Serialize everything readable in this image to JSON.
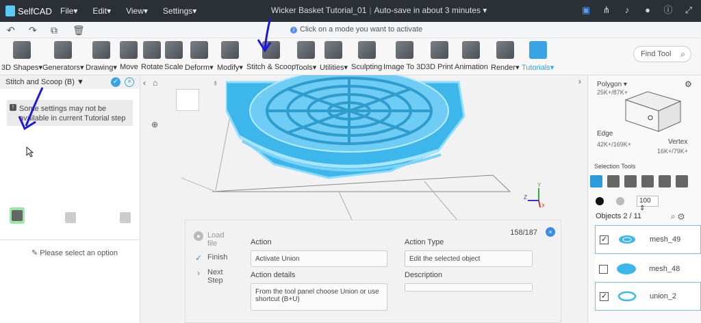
{
  "app": {
    "name": "SelfCAD"
  },
  "menus": [
    "File",
    "Edit",
    "View",
    "Settings"
  ],
  "document": {
    "title": "Wicker Basket Tutorial_01",
    "autosave": "Auto-save in about 3 minutes"
  },
  "hint": "Click on a mode you want to activate",
  "tools": [
    {
      "label": "3D Shapes",
      "dropdown": true
    },
    {
      "label": "Generators",
      "dropdown": true
    },
    {
      "label": "Drawing",
      "dropdown": true
    },
    {
      "label": "Move"
    },
    {
      "label": "Rotate"
    },
    {
      "label": "Scale"
    },
    {
      "label": "Deform",
      "dropdown": true
    },
    {
      "label": "Modify",
      "dropdown": true
    },
    {
      "label": "Stitch & Scoop"
    },
    {
      "label": "Tools",
      "dropdown": true
    },
    {
      "label": "Utilities",
      "dropdown": true
    },
    {
      "label": "Sculpting"
    },
    {
      "label": "Image To 3D"
    },
    {
      "label": "3D Print"
    },
    {
      "label": "Animation"
    },
    {
      "label": "Render",
      "dropdown": true
    },
    {
      "label": "Tutorials",
      "dropdown": true,
      "active": true
    }
  ],
  "find_tool": {
    "placeholder": "Find Tool"
  },
  "left_panel": {
    "title": "Stitch and Scoop (B)",
    "note": "Some settings may not be available in current Tutorial step",
    "message": "Please select an option"
  },
  "tutorial": {
    "steps": {
      "load": "Load file",
      "finish": "Finish",
      "next": "Next Step"
    },
    "counter": "158/187",
    "action_label": "Action",
    "action_value": "Activate Union",
    "details_label": "Action details",
    "details_value": "From the tool panel choose Union or use shortcut (B+U)",
    "type_label": "Action Type",
    "type_value": "Edit the selected object",
    "description_label": "Description",
    "description_value": ""
  },
  "right_panel": {
    "polygon_label": "Polygon",
    "polygon_stats": "25K+/87K+",
    "edge_label": "Edge",
    "edge_stats": "42K+/169K+",
    "vertex_label": "Vertex",
    "vertex_stats": "16K+/79K+",
    "selection_tools": "Selection Tools",
    "opacity": "100",
    "objects_header": "Objects 2 / 11",
    "objects": [
      {
        "name": "mesh_49",
        "checked": true,
        "selected": true
      },
      {
        "name": "mesh_48",
        "checked": false,
        "selected": false
      },
      {
        "name": "union_2",
        "checked": true,
        "selected": true
      }
    ]
  },
  "axes": {
    "x": "X",
    "y": "Y",
    "z": "Z"
  },
  "colors": {
    "topbar": "#2b2f36",
    "accent": "#3aa3e3",
    "mesh": "#3db6ec",
    "annotation": "#1a1ad6"
  }
}
